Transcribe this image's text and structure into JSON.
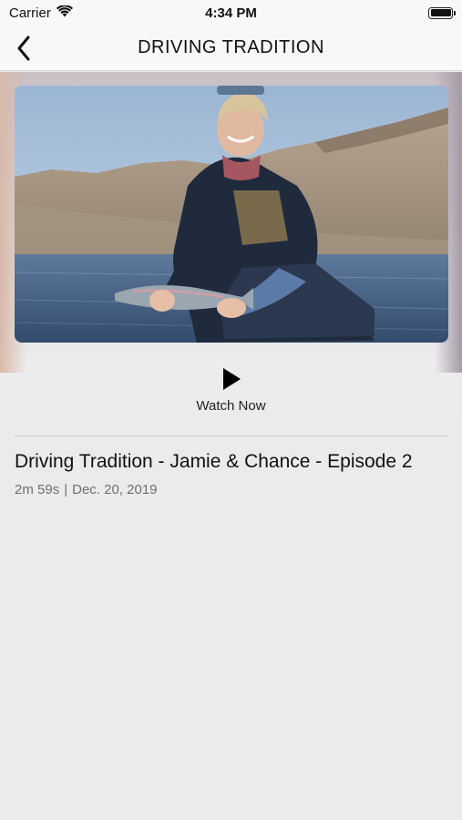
{
  "status_bar": {
    "carrier": "Carrier",
    "time": "4:34 PM"
  },
  "nav": {
    "title": "DRIVING TRADITION"
  },
  "player": {
    "watch_label": "Watch Now"
  },
  "episode": {
    "title": "Driving Tradition - Jamie & Chance - Episode 2",
    "duration": "2m 59s",
    "separator": "|",
    "date": "Dec. 20, 2019"
  }
}
